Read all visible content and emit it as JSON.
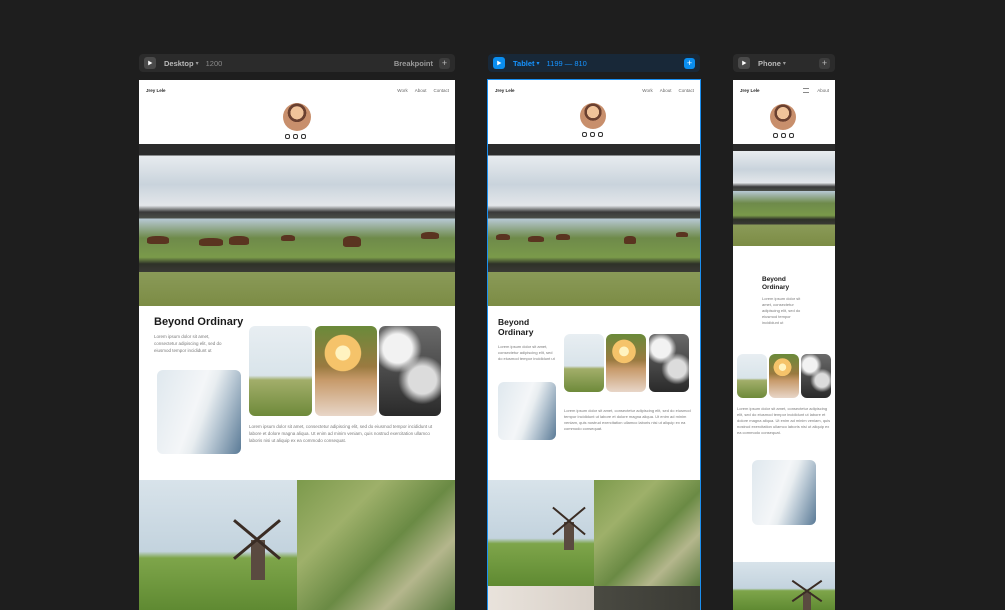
{
  "toolbars": [
    {
      "label": "Desktop",
      "size": "1200",
      "right_label": "Breakpoint"
    },
    {
      "label": "Tablet",
      "size": "1199 — 810",
      "right_label": ""
    },
    {
      "label": "Phone",
      "size": "",
      "right_label": ""
    }
  ],
  "site": {
    "brand": "Jrey Lele",
    "nav_desktop": [
      "Work",
      "About",
      "Contact"
    ],
    "nav_phone": [
      "About"
    ],
    "heading_desktop": "Beyond Ordinary",
    "heading_line1": "Beyond",
    "heading_line2": "Ordinary",
    "intro_text": "Lorem ipsum dolor sit amet, consectetur adipiscing elit, sed do eiusmod tempor incididunt ut",
    "body_text": "Lorem ipsum dolor sit amet, consectetur adipiscing elit, sed do eiusmod tempor incididunt ut labore et dolore magna aliqua. Ut enim ad minim veniam, quis nostrud exercitation ullamco laboris nisi ut aliquip ex ea commodo consequat."
  },
  "icons": [
    "play-icon",
    "chevron-down-icon",
    "plus-icon",
    "twitter-icon",
    "facebook-icon",
    "instagram-icon",
    "menu-icon"
  ],
  "colors": {
    "canvas": "#1e1e1e",
    "accent": "#1693ff",
    "page": "#ffffff"
  }
}
